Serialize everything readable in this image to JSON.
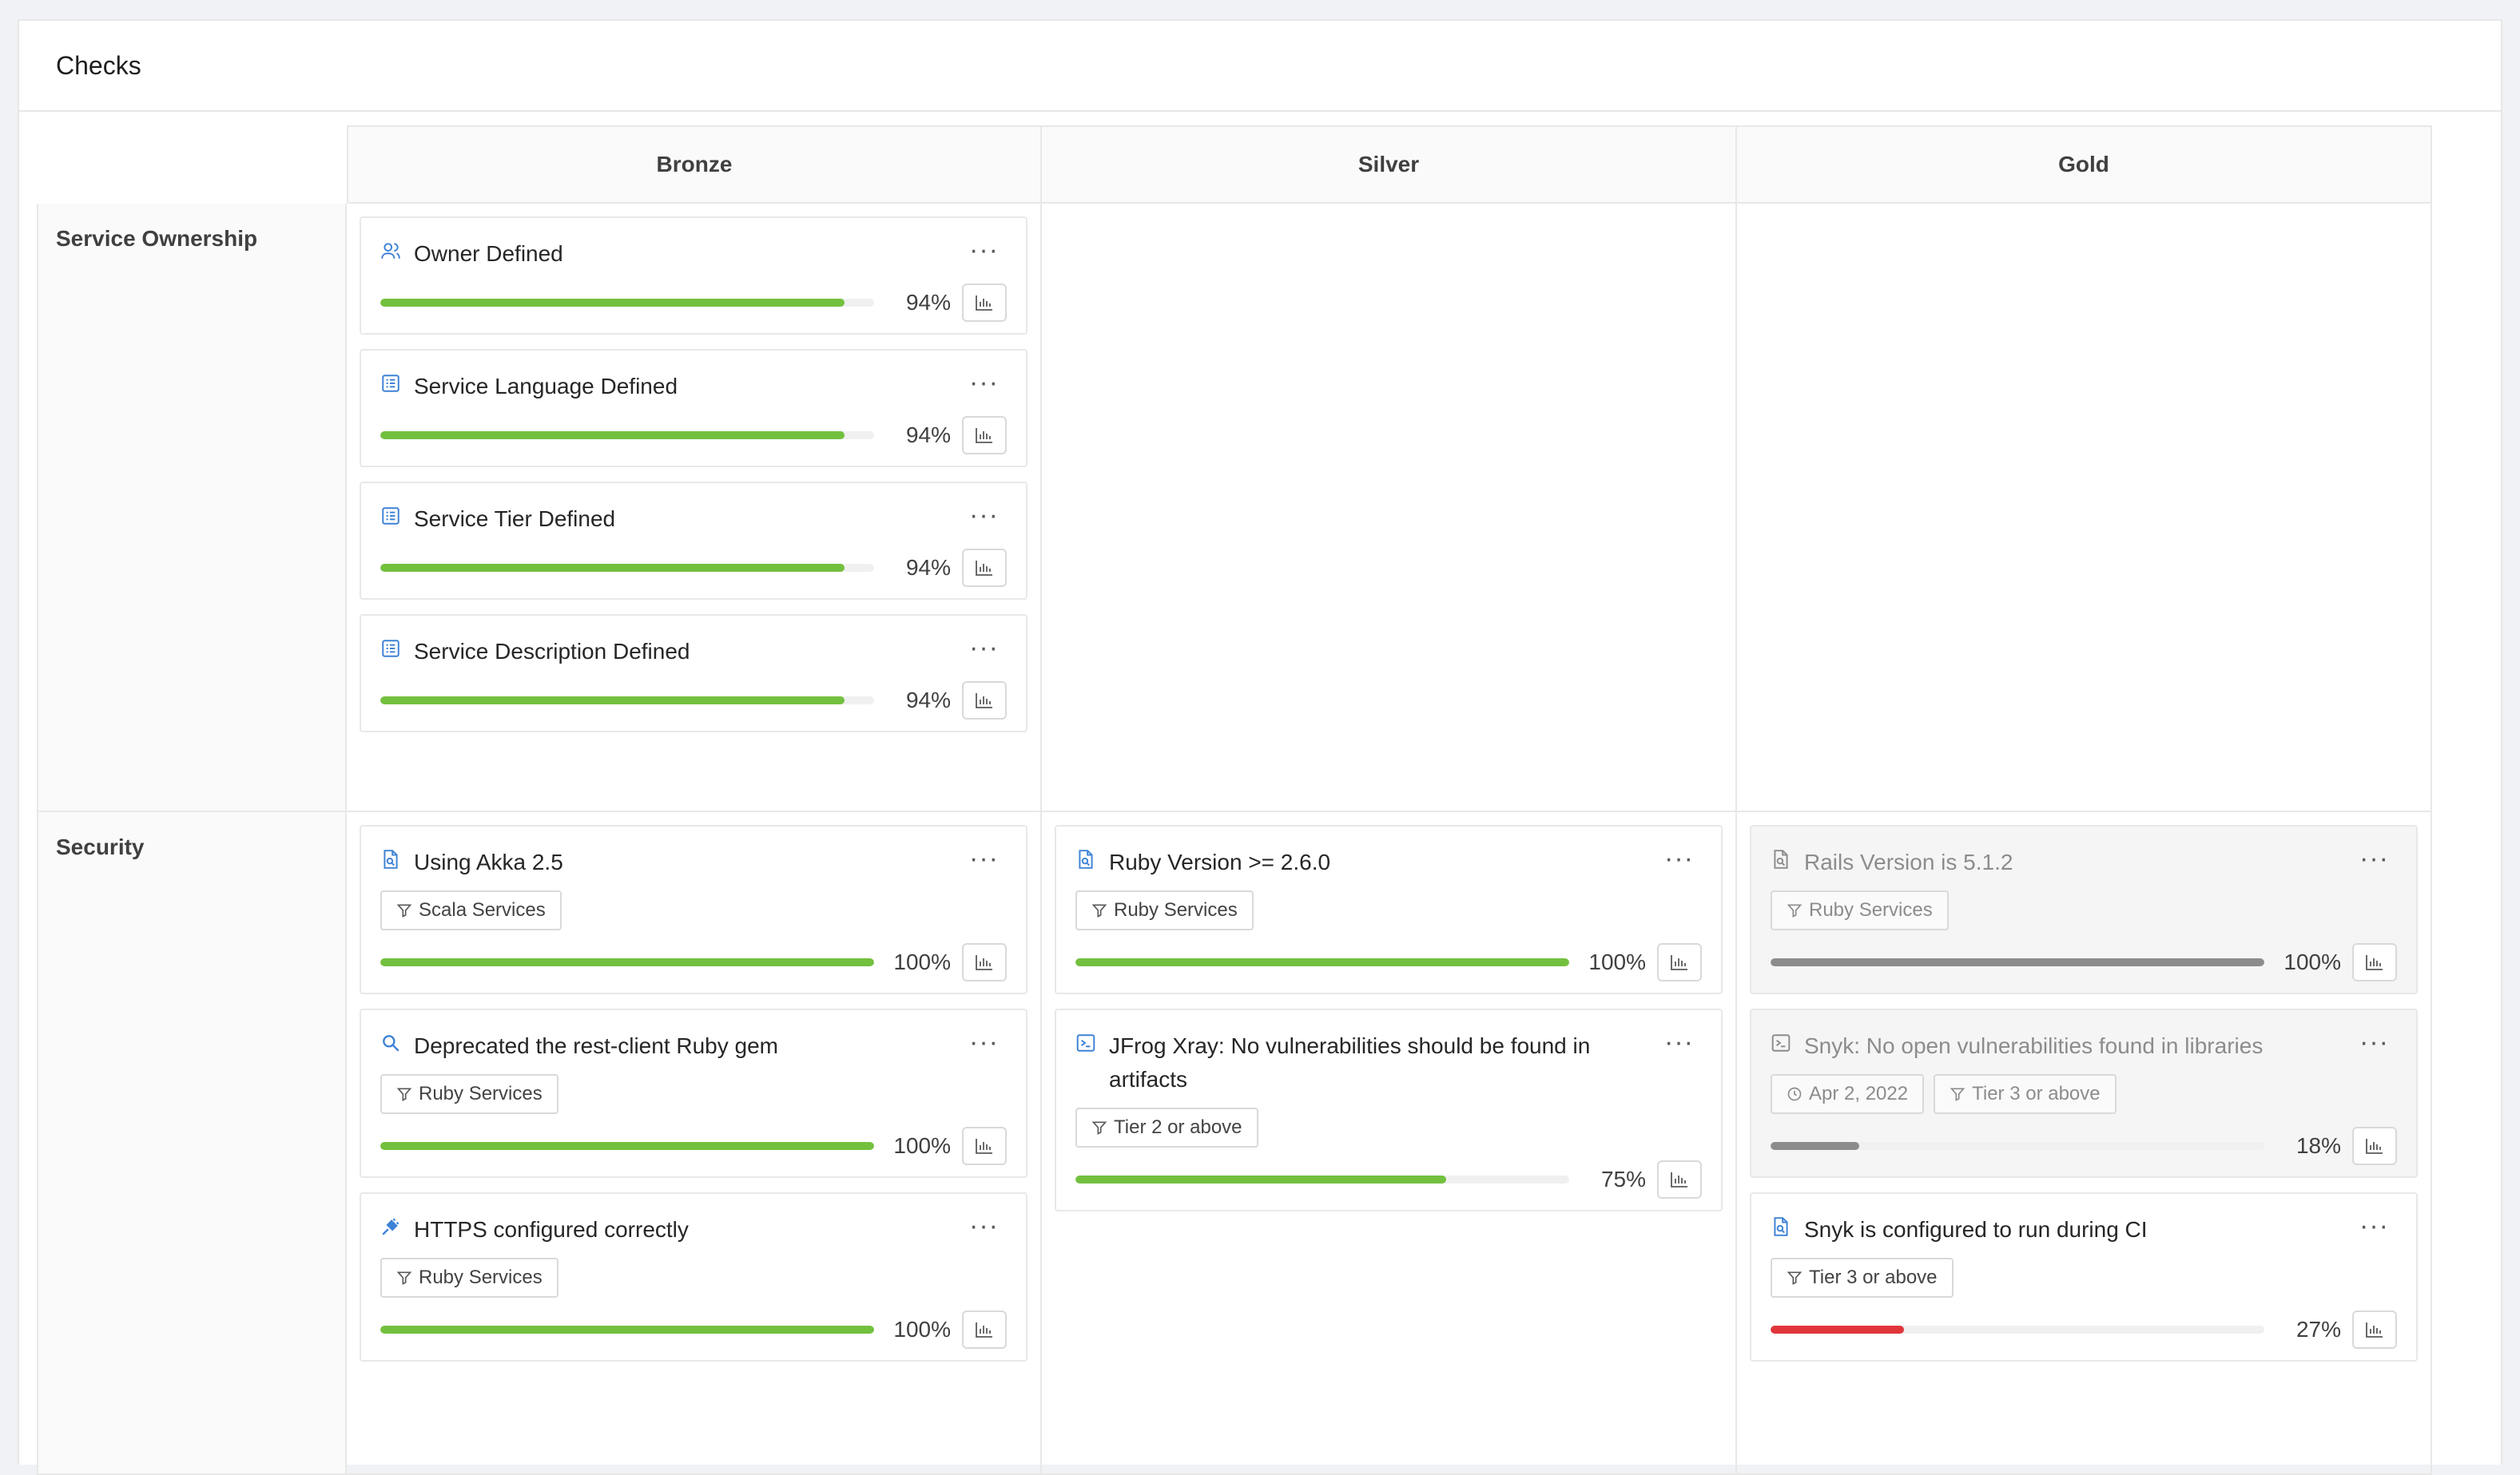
{
  "header": {
    "title": "Checks"
  },
  "columns": [
    "Bronze",
    "Silver",
    "Gold"
  ],
  "colors": {
    "green": "#73c03e",
    "gray": "#8c8c8c",
    "red": "#e0353b",
    "icon_blue": "#3d82d6"
  },
  "rows": [
    {
      "label": "Service Ownership",
      "cells": [
        [
          {
            "title": "Owner Defined",
            "icon": "user-icon",
            "tags": [],
            "percent_label": "94%",
            "progress": 94,
            "color": "green",
            "disabled": false
          },
          {
            "title": "Service Language Defined",
            "icon": "list-icon",
            "tags": [],
            "percent_label": "94%",
            "progress": 94,
            "color": "green",
            "disabled": false
          },
          {
            "title": "Service Tier Defined",
            "icon": "list-icon",
            "tags": [],
            "percent_label": "94%",
            "progress": 94,
            "color": "green",
            "disabled": false
          },
          {
            "title": "Service Description Defined",
            "icon": "list-icon",
            "tags": [],
            "percent_label": "94%",
            "progress": 94,
            "color": "green",
            "disabled": false
          }
        ],
        [],
        []
      ]
    },
    {
      "label": "Security",
      "cells": [
        [
          {
            "title": "Using Akka 2.5",
            "icon": "file-search-icon",
            "tags": [
              {
                "icon": "filter-icon",
                "text": "Scala Services"
              }
            ],
            "percent_label": "100%",
            "progress": 100,
            "color": "green",
            "disabled": false
          },
          {
            "title": "Deprecated the rest-client Ruby gem",
            "icon": "search-icon",
            "tags": [
              {
                "icon": "filter-icon",
                "text": "Ruby Services"
              }
            ],
            "percent_label": "100%",
            "progress": 100,
            "color": "green",
            "disabled": false
          },
          {
            "title": "HTTPS configured correctly",
            "icon": "plug-icon",
            "tags": [
              {
                "icon": "filter-icon",
                "text": "Ruby Services"
              }
            ],
            "percent_label": "100%",
            "progress": 100,
            "color": "green",
            "disabled": false
          }
        ],
        [
          {
            "title": "Ruby Version >= 2.6.0",
            "icon": "file-search-icon",
            "tags": [
              {
                "icon": "filter-icon",
                "text": "Ruby Services"
              }
            ],
            "percent_label": "100%",
            "progress": 100,
            "color": "green",
            "disabled": false
          },
          {
            "title": "JFrog Xray: No vulnerabilities should be found in artifacts",
            "icon": "terminal-icon",
            "tags": [
              {
                "icon": "filter-icon",
                "text": "Tier 2 or above"
              }
            ],
            "percent_label": "75%",
            "progress": 75,
            "color": "green",
            "disabled": false
          }
        ],
        [
          {
            "title": "Rails Version is 5.1.2",
            "icon": "file-search-icon",
            "tags": [
              {
                "icon": "filter-icon",
                "text": "Ruby Services"
              }
            ],
            "percent_label": "100%",
            "progress": 100,
            "color": "gray",
            "disabled": true
          },
          {
            "title": "Snyk: No open vulnerabilities found in libraries",
            "icon": "terminal-icon",
            "tags": [
              {
                "icon": "clock-icon",
                "text": "Apr 2, 2022"
              },
              {
                "icon": "filter-icon",
                "text": "Tier 3 or above"
              }
            ],
            "percent_label": "18%",
            "progress": 18,
            "color": "gray",
            "disabled": true
          },
          {
            "title": "Snyk is configured to run during CI",
            "icon": "file-search-icon",
            "tags": [
              {
                "icon": "filter-icon",
                "text": "Tier 3 or above"
              }
            ],
            "percent_label": "27%",
            "progress": 27,
            "color": "red",
            "disabled": false
          }
        ]
      ]
    }
  ]
}
